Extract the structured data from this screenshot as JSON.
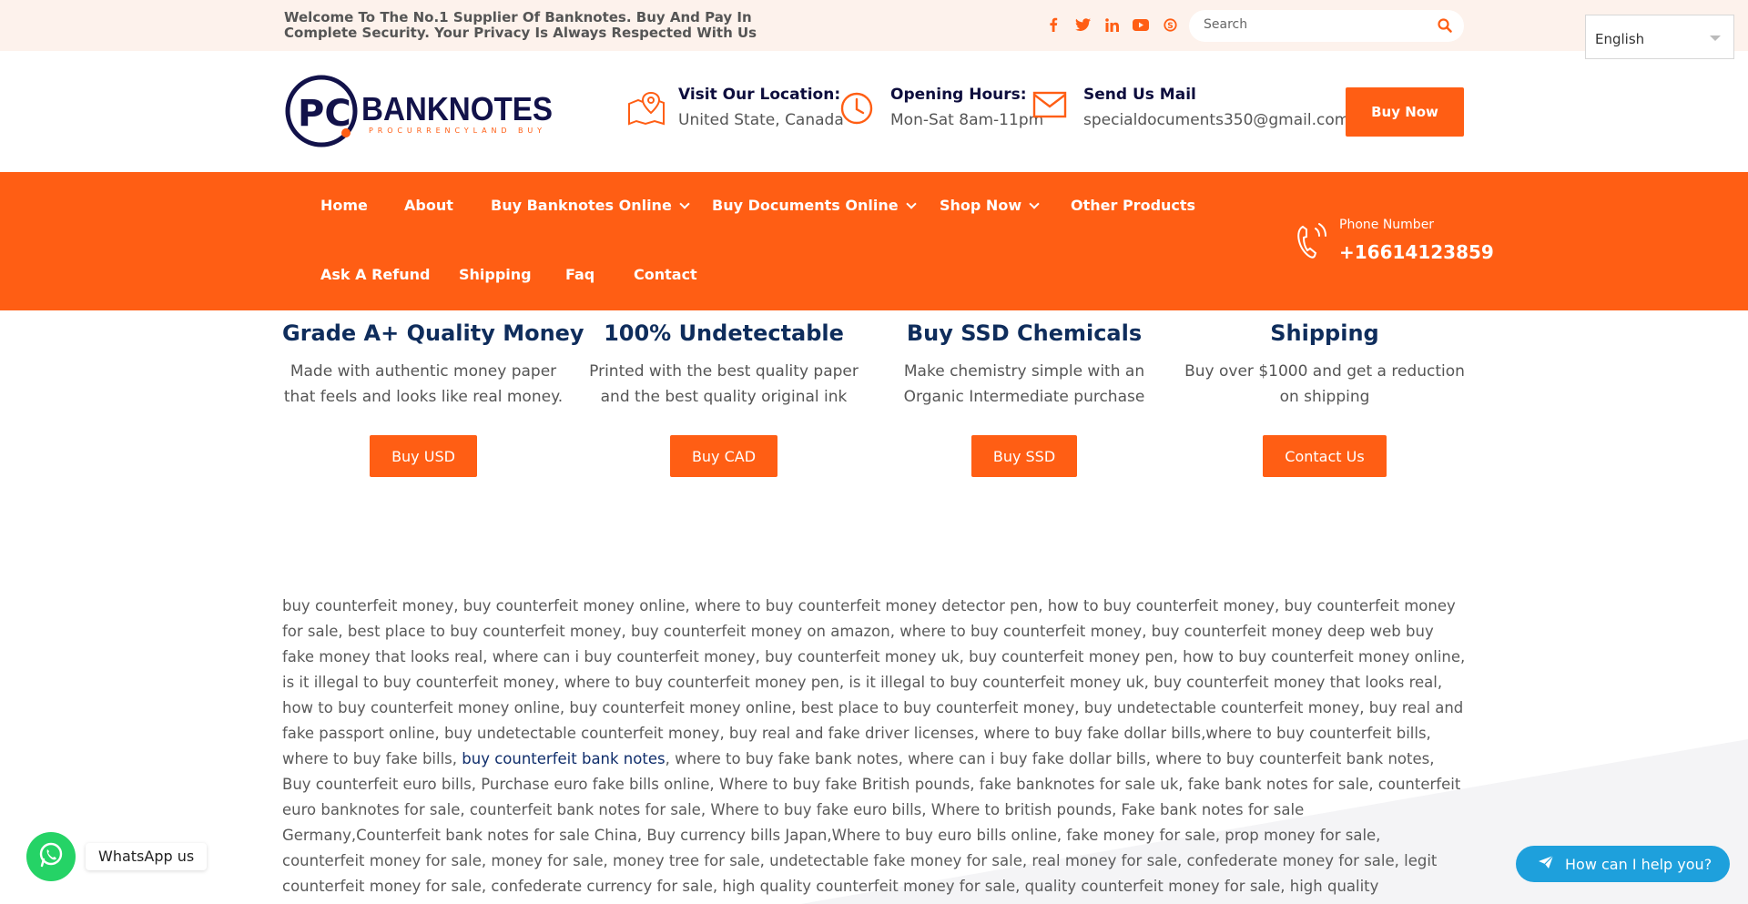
{
  "topbar": {
    "welcome_text": "Welcome To The No.1 Supplier Of Banknotes. Buy And Pay In Complete Security. Your Privacy Is Always Respected With Us",
    "social_icons": [
      "facebook-icon",
      "twitter-icon",
      "linkedin-icon",
      "youtube-icon",
      "skype-icon"
    ],
    "search": {
      "placeholder": "Search"
    },
    "language": {
      "selected": "English"
    }
  },
  "header": {
    "logo": {
      "text": "BANKNOTES",
      "sub": "PROCURRENCYLAND BUY",
      "initials": "PC"
    },
    "location": {
      "title": "Visit Our Location:",
      "value": "United State, Canada"
    },
    "hours": {
      "title": "Opening Hours:",
      "value": "Mon-Sat 8am-11pm"
    },
    "mail": {
      "title": "Send Us Mail",
      "value": "specialdocuments350@gmail.com"
    },
    "buy_now_label": "Buy Now"
  },
  "nav": {
    "items": [
      {
        "label": "Home"
      },
      {
        "label": "About"
      },
      {
        "label": "Buy Banknotes Online"
      },
      {
        "label": "Buy Documents Online"
      },
      {
        "label": "Shop Now"
      },
      {
        "label": "Other Products"
      },
      {
        "label": "Ask A Refund"
      },
      {
        "label": "Shipping"
      },
      {
        "label": "Faq"
      },
      {
        "label": "Contact"
      }
    ],
    "phone_label": "Phone Number",
    "phone_number": "+16614123859"
  },
  "features": [
    {
      "title": "Grade A+ Quality Money",
      "text": "Made with authentic money paper that feels and looks like real money.",
      "button": "Buy USD"
    },
    {
      "title": "100% Undetectable",
      "text": "Printed with the best quality paper and the best quality original ink",
      "button": "Buy CAD"
    },
    {
      "title": "Buy SSD Chemicals",
      "text": "Make chemistry simple with an Organic Intermediate purchase",
      "button": "Buy SSD"
    },
    {
      "title": "Shipping",
      "text": "Buy over $1000 and get a reduction on shipping",
      "button": "Contact Us"
    }
  ],
  "seo": {
    "part1": "buy counterfeit money, buy counterfeit money online, where to buy counterfeit money detector pen, how to buy counterfeit money, buy counterfeit money for sale, best place to buy counterfeit money, buy counterfeit money on amazon, where to buy counterfeit money, buy counterfeit money deep web buy fake money that looks real, where can i buy counterfeit money, buy counterfeit money uk, buy counterfeit money pen, how to buy counterfeit money online, is it illegal to buy counterfeit money, where to buy counterfeit money pen, is it illegal to buy counterfeit money uk, buy counterfeit money that looks real, how to buy counterfeit money online, buy counterfeit money online, best place to buy counterfeit money, buy undetectable counterfeit money, buy real and fake passport online, buy undetectable counterfeit money, buy real and fake driver licenses, where to buy fake dollar bills,where to buy counterfeit bills, where to buy fake bills, ",
    "link": "buy counterfeit bank notes",
    "part2": ", where to buy fake bank notes, where can i buy fake dollar bills, where to buy counterfeit bank notes, Buy counterfeit euro bills, Purchase euro fake bills online, Where to buy fake British pounds, fake banknotes for sale uk, fake bank notes for sale, counterfeit euro banknotes for sale, counterfeit bank notes for sale, Where to buy fake euro bills, Where to british pounds, Fake bank notes for sale Germany,Counterfeit bank notes for sale China, Buy currency bills Japan,Where to buy euro bills online, fake money for sale, prop money for sale, counterfeit money for sale, money for sale, money tree for sale, undetectable fake money for sale, real money for sale, confederate money for sale, legit counterfeit money for sale, confederate currency for sale, high quality counterfeit money for sale, quality counterfeit money for sale, high quality undetectable, counterfeit banknotes for sale, currency for sale, banknotes for sale, best counterfeit money for"
  },
  "floating": {
    "whatsapp_label": "WhatsApp us",
    "help_label": "How can I help you?"
  },
  "colors": {
    "accent": "#ff5e14",
    "heading": "#0f2d5c",
    "whatsapp": "#25d366",
    "help": "#1ea0dc"
  }
}
